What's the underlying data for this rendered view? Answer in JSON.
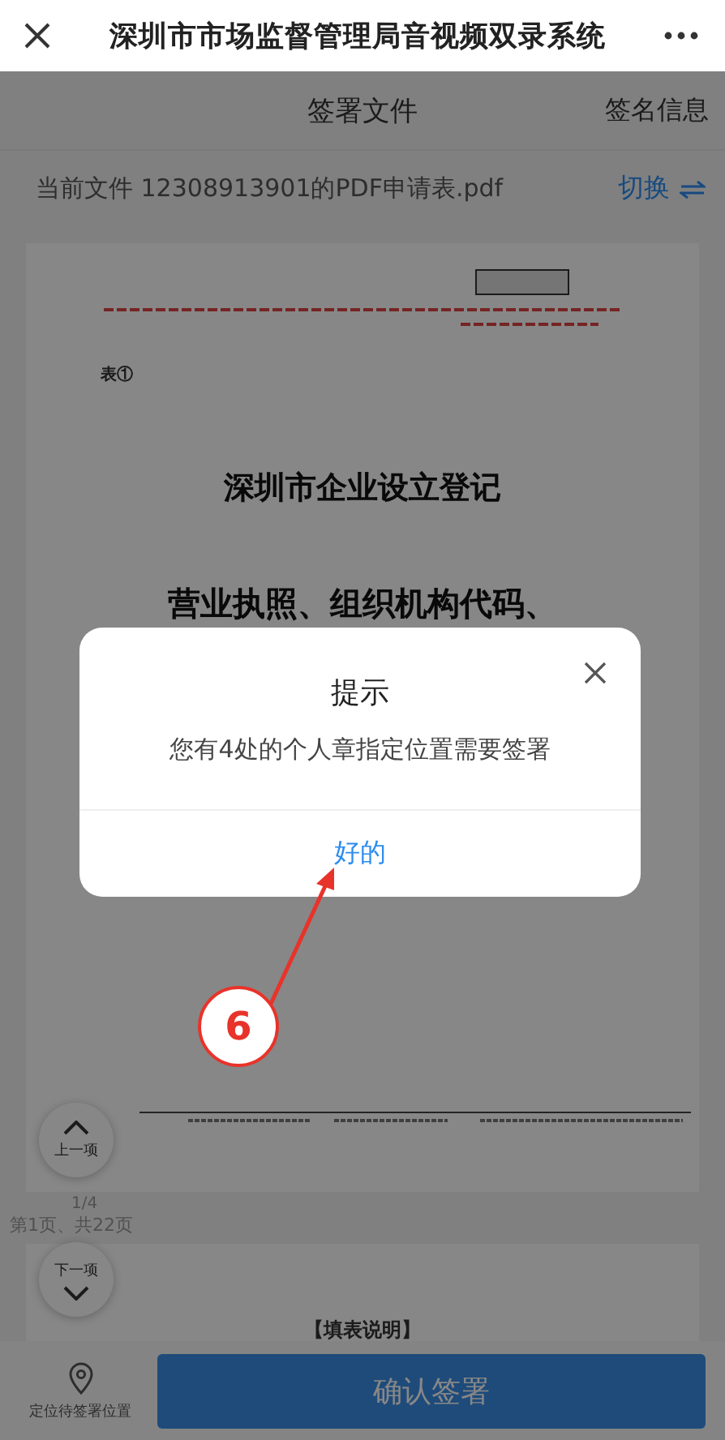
{
  "top_bar": {
    "title": "深圳市市场监督管理局音视频双录系统"
  },
  "header": {
    "title": "签署文件",
    "action": "签名信息"
  },
  "file_bar": {
    "label": "当前文件 12308913901的PDF申请表.pdf",
    "switch": "切换"
  },
  "document": {
    "mark": "表①",
    "title": "深圳市企业设立登记",
    "subtitle": "营业执照、组织机构代码、",
    "page_counter": "1/4",
    "page_info": "第1页、共22页",
    "next_heading": "【填表说明】"
  },
  "nav": {
    "prev": "上一项",
    "next": "下一项"
  },
  "bottom_bar": {
    "locate": "定位待签署位置",
    "confirm": "确认签署"
  },
  "dialog": {
    "title": "提示",
    "message": "您有4处的个人章指定位置需要签署",
    "ok": "好的"
  },
  "annotation": {
    "step": "6"
  }
}
